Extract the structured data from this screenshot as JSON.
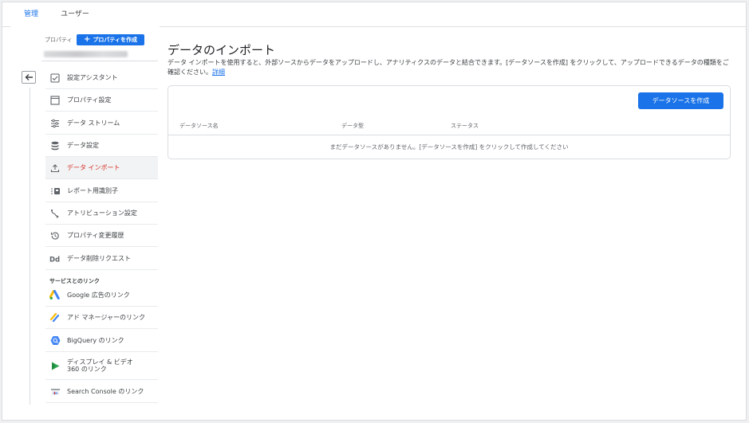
{
  "tabs": [
    {
      "label": "管理",
      "active": true
    },
    {
      "label": "ユーザー",
      "active": false
    }
  ],
  "sidebar": {
    "property_label": "プロパティ",
    "create_property_label": "プロパティを作成",
    "items": [
      {
        "label": "設定アシスタント",
        "icon": "checkbox-icon"
      },
      {
        "label": "プロパティ設定",
        "icon": "property-settings-icon"
      },
      {
        "label": "データ ストリーム",
        "icon": "data-streams-icon"
      },
      {
        "label": "データ設定",
        "icon": "database-icon"
      },
      {
        "label": "データ インポート",
        "icon": "upload-icon",
        "active": true
      },
      {
        "label": "レポート用識別子",
        "icon": "reporting-identity-icon"
      },
      {
        "label": "アトリビューション設定",
        "icon": "attribution-icon"
      },
      {
        "label": "プロパティ変更履歴",
        "icon": "history-icon"
      },
      {
        "label": "データ削除リクエスト",
        "icon": "data-deletion-icon"
      }
    ],
    "section_title": "サービスとのリンク",
    "links": [
      {
        "label": "Google 広告のリンク",
        "icon": "google-ads-icon"
      },
      {
        "label": "アド マネージャーのリンク",
        "icon": "ad-manager-icon"
      },
      {
        "label": "BigQuery のリンク",
        "icon": "bigquery-icon"
      },
      {
        "label": "ディスプレイ & ビデオ 360 のリンク",
        "icon": "dv360-icon"
      },
      {
        "label": "Search Console のリンク",
        "icon": "search-console-icon"
      }
    ]
  },
  "main": {
    "title": "データのインポート",
    "description": "データ インポートを使用すると、外部ソースからデータをアップロードし、アナリティクスのデータと結合できます。[データソースを作成] をクリックして、アップロードできるデータの種類をご確認ください。",
    "details_link": "詳細",
    "create_button": "データソースを作成",
    "columns": [
      "データソース名",
      "データ型",
      "ステータス"
    ],
    "empty_message": "まだデータソースがありません。[データソースを作成] をクリックして作成してください"
  },
  "colors": {
    "accent": "#1a73e8",
    "active_text": "#d93025",
    "tab_indicator": "#f29900"
  }
}
